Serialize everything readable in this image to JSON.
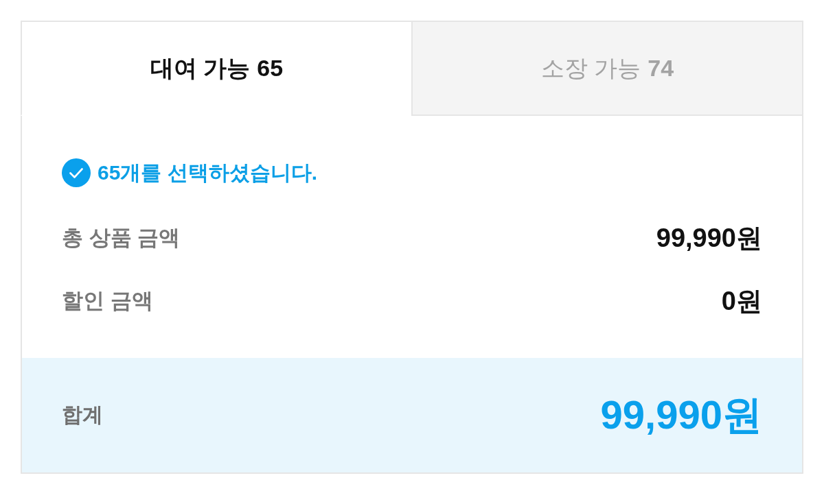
{
  "tabs": [
    {
      "label": "대여 가능",
      "count": "65",
      "selected": true
    },
    {
      "label": "소장 가능",
      "count": "74",
      "selected": false
    }
  ],
  "selection": {
    "message": "65개를 선택하셨습니다."
  },
  "summary": [
    {
      "label": "총 상품 금액",
      "value": "99,990원"
    },
    {
      "label": "할인 금액",
      "value": "0원"
    }
  ],
  "total": {
    "label": "합계",
    "value": "99,990원"
  }
}
